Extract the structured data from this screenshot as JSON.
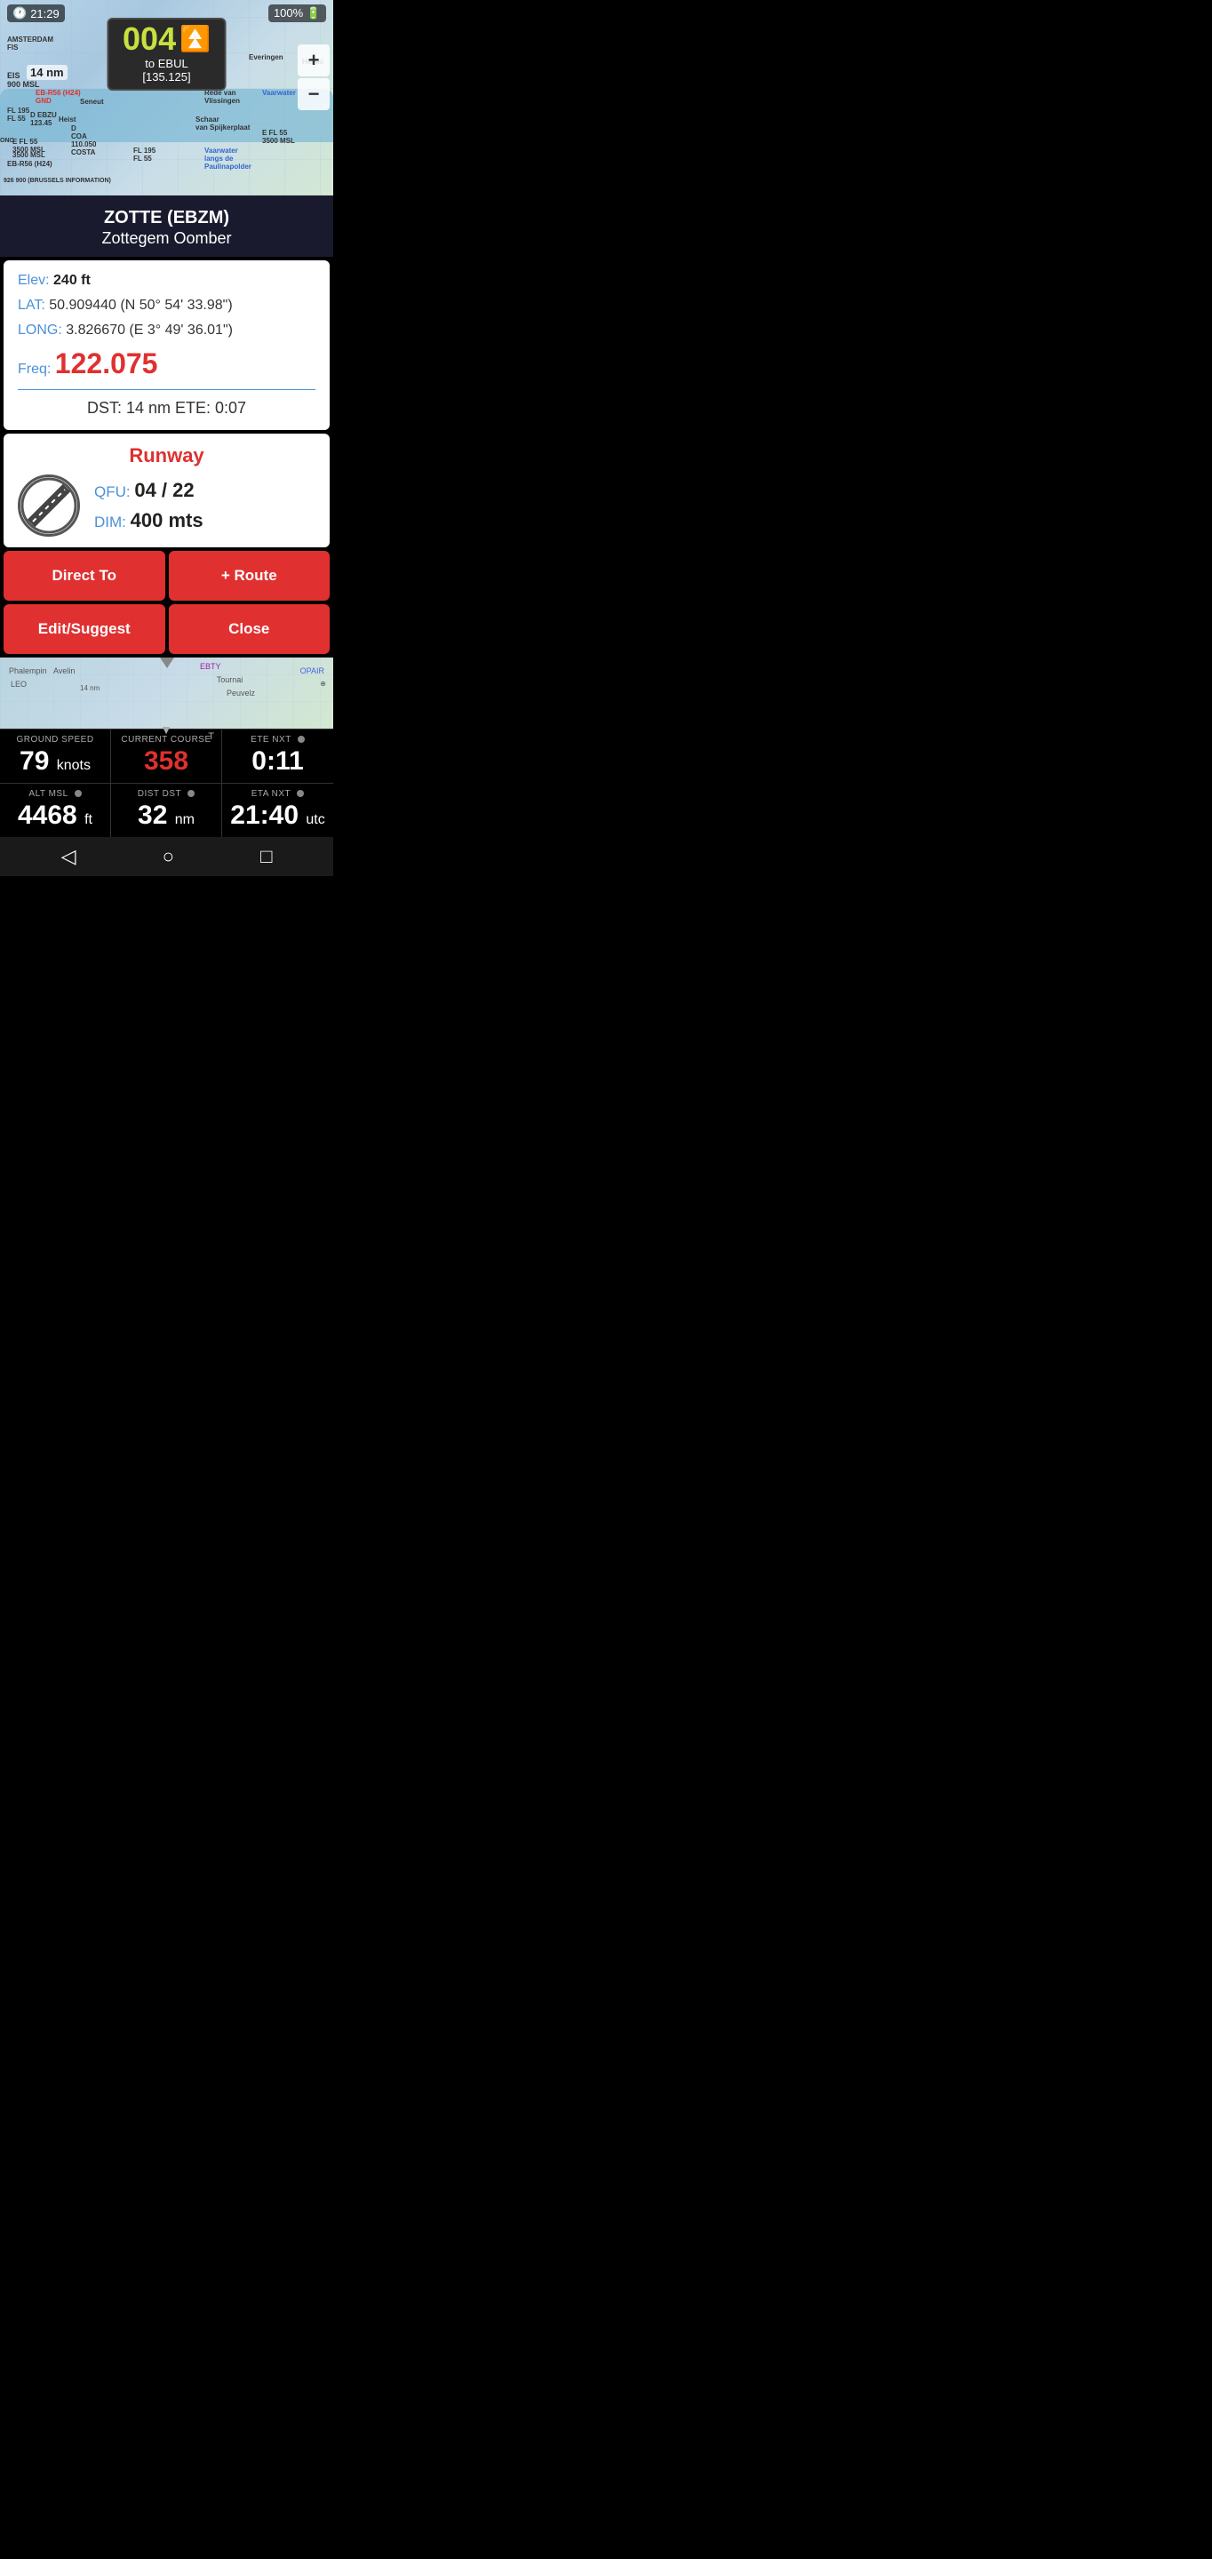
{
  "statusBar": {
    "time": "21:29",
    "battery": "100%",
    "clockIcon": "clock-icon",
    "batteryIcon": "battery-icon"
  },
  "map": {
    "heading": {
      "number": "004",
      "arrowsIcon": "double-chevron-up-icon",
      "destLabel": "to EBUL",
      "destFreq": "[135.125]"
    },
    "distLabel": "14 nm",
    "ebtyLabel": "EBTY",
    "zoomIn": "+",
    "zoomOut": "−"
  },
  "airport": {
    "icao": "ZOTTE (EBZM)",
    "name": "Zottegem Oomber"
  },
  "details": {
    "elevLabel": "Elev:",
    "elevValue": "240 ft",
    "latLabel": "LAT:",
    "latValue": "50.909440  (N 50° 54' 33.98\")",
    "longLabel": "LONG:",
    "longValue": "3.826670  (E 3° 49' 36.01\")",
    "freqLabel": "Freq:",
    "freqValue": "122.075",
    "dstLabel": "DST:",
    "dstValue": "14 nm",
    "eteLabel": "ETE:",
    "eteValue": "0:07",
    "dstEteText": "DST: 14 nm    ETE: 0:07"
  },
  "runway": {
    "title": "Runway",
    "qfuLabel": "QFU:",
    "qfuValue": "04 / 22",
    "dimLabel": "DIM:",
    "dimValue": "400 mts",
    "iconAlt": "runway-diagram-icon"
  },
  "buttons": {
    "directTo": "Direct To",
    "route": "+ Route",
    "editSuggest": "Edit/Suggest",
    "close": "Close"
  },
  "bottomStats": {
    "row1": [
      {
        "label": "GROUND SPEED",
        "value": "79",
        "unit": "knots",
        "valueClass": "white"
      },
      {
        "label": "CURRENT COURSE",
        "value": "358",
        "unit": "",
        "valueClass": "red",
        "hasArrow": true,
        "hasTLabel": true
      },
      {
        "label": "ETE nxt",
        "value": "0:11",
        "unit": "",
        "valueClass": "white",
        "hasDot": true
      }
    ],
    "row2": [
      {
        "label": "ALT MSL",
        "value": "4468",
        "unit": "ft",
        "valueClass": "white",
        "hasDot": true
      },
      {
        "label": "DIST dst",
        "value": "32",
        "unit": "nm",
        "valueClass": "white",
        "hasDot": true
      },
      {
        "label": "ETA nxt",
        "value": "21:40",
        "unit": "utc",
        "valueClass": "white",
        "hasDot": true
      }
    ]
  },
  "bottomNav": {
    "backIcon": "◁",
    "homeIcon": "○",
    "squareIcon": "□"
  }
}
